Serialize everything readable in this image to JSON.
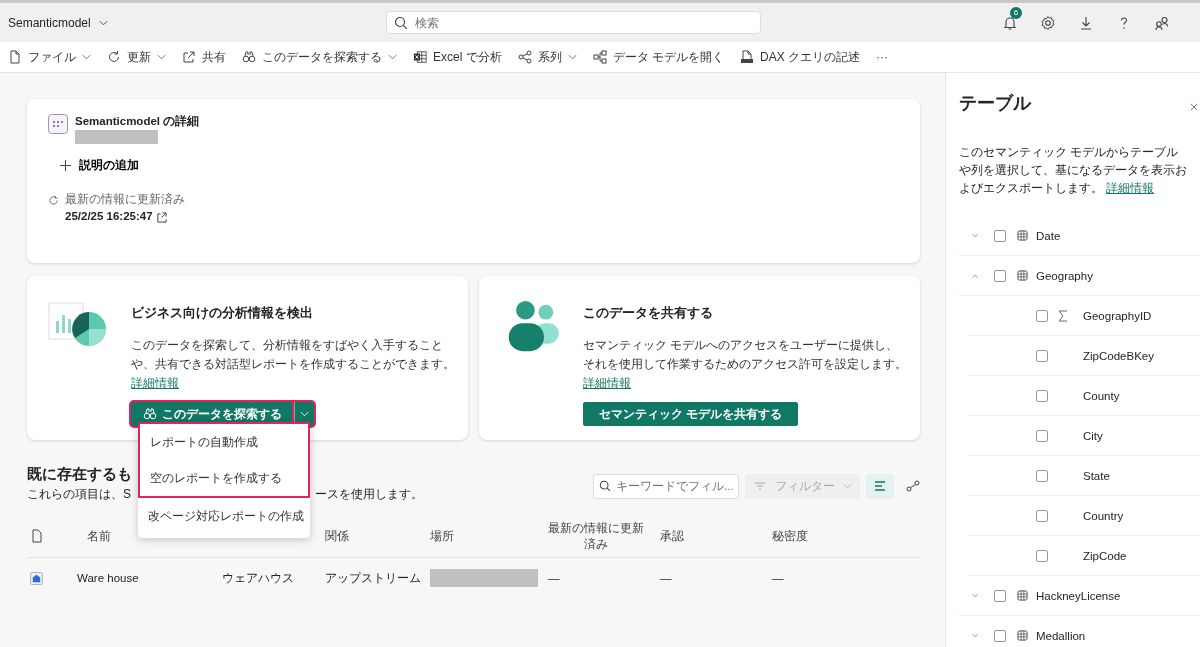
{
  "top_bar": {
    "title": "Semanticmodel",
    "search_placeholder": "検索",
    "notification_count": "6"
  },
  "toolbar": [
    {
      "label": "ファイル",
      "kind": "file",
      "dropdown": true
    },
    {
      "label": "更新",
      "kind": "refresh",
      "dropdown": true
    },
    {
      "label": "共有",
      "kind": "share",
      "dropdown": false
    },
    {
      "label": "このデータを探索する",
      "kind": "explore",
      "dropdown": true
    },
    {
      "label": "Excel で分析",
      "kind": "excel",
      "dropdown": false
    },
    {
      "label": "系列",
      "kind": "lineage",
      "dropdown": true
    },
    {
      "label": "データ モデルを開く",
      "kind": "model",
      "dropdown": false
    },
    {
      "label": "DAX クエリの記述",
      "kind": "dax",
      "dropdown": false
    },
    {
      "label": "···",
      "kind": "more",
      "dropdown": false
    }
  ],
  "details": {
    "title": "Semanticmodel の詳細",
    "add_description": "説明の追加",
    "refresh_label": "最新の情報に更新済み",
    "refresh_time": "25/2/25 16:25:47"
  },
  "cards": [
    {
      "kind": "insights",
      "title": "ビジネス向けの分析情報を検出",
      "text": "このデータを探索して、分析情報をすばやく入手することや、共有できる対話型レポートを作成することができます。",
      "link": "詳細情報",
      "button": "このデータを探索する",
      "split": true,
      "highlighted": true
    },
    {
      "kind": "share",
      "title": "このデータを共有する",
      "text": "セマンティック モデルへのアクセスをユーザーに提供し、それを使用して作業するためのアクセス許可を設定します。",
      "link": "詳細情報",
      "button": "セマンティック モデルを共有する",
      "split": false,
      "highlighted": false
    }
  ],
  "menu": {
    "items": [
      {
        "label": "レポートの自動作成",
        "highlighted": true
      },
      {
        "label": "空のレポートを作成する",
        "highlighted": true
      },
      {
        "label": "改ページ対応レポートの作成",
        "highlighted": false
      }
    ]
  },
  "section": {
    "title": "既に存在するも",
    "subtitle_parts": [
      "これらの項目は、S",
      "ースを使用します。"
    ],
    "search_placeholder": "キーワードでフィル...",
    "filter": {
      "label": "フィルター",
      "disabled": true
    }
  },
  "table": {
    "columns": [
      "名前",
      "関係",
      "場所",
      "最新の情報に更新済み",
      "承認",
      "秘密度"
    ],
    "rows": [
      {
        "name": "Ware house",
        "column_3": "ウェアハウス",
        "relation": "アップストリーム",
        "refreshed": "—",
        "endorsement": "—",
        "sensitivity": "—"
      }
    ]
  },
  "panel": {
    "title": "テーブル",
    "text": "このセマンティック モデルからテーブルや列を選択して、基になるデータを表示およびエクスポートします。",
    "link": "詳細情報",
    "tables": [
      {
        "name": "Date",
        "expanded": false,
        "checked": false
      },
      {
        "name": "Geography",
        "expanded": true,
        "checked": false,
        "children": [
          {
            "name": "GeographyID",
            "kind": "sum",
            "checked": false
          },
          {
            "name": "ZipCodeBKey",
            "kind": "text",
            "checked": false
          },
          {
            "name": "County",
            "kind": "text",
            "checked": false
          },
          {
            "name": "City",
            "kind": "text",
            "checked": false
          },
          {
            "name": "State",
            "kind": "text",
            "checked": false
          },
          {
            "name": "Country",
            "kind": "text",
            "checked": false
          },
          {
            "name": "ZipCode",
            "kind": "text",
            "checked": false
          }
        ]
      },
      {
        "name": "HackneyLicense",
        "expanded": false,
        "checked": false
      },
      {
        "name": "Medallion",
        "expanded": false,
        "checked": false
      }
    ]
  }
}
